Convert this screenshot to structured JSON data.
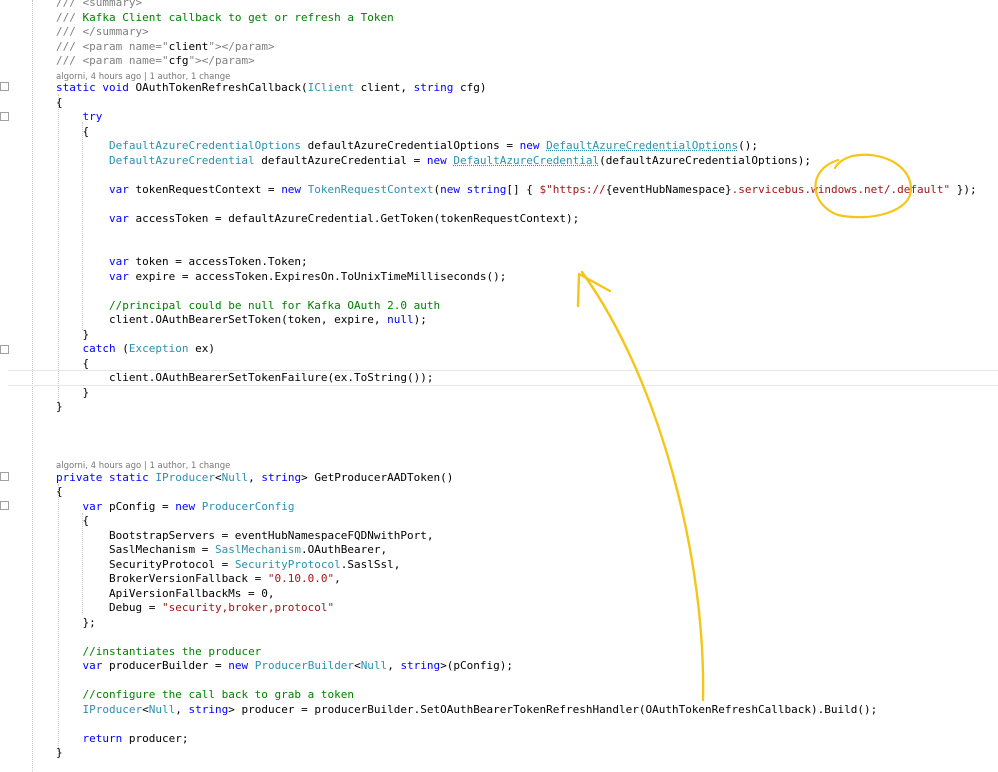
{
  "code": [
    {
      "kind": "code",
      "tokens": [
        {
          "t": "/// ",
          "c": "doc"
        },
        {
          "t": "<summary>",
          "c": "doc"
        }
      ]
    },
    {
      "kind": "code",
      "tokens": [
        {
          "t": "/// ",
          "c": "doc"
        },
        {
          "t": "Kafka Client callback to get or refresh a Token",
          "c": "cm"
        }
      ]
    },
    {
      "kind": "code",
      "tokens": [
        {
          "t": "/// ",
          "c": "doc"
        },
        {
          "t": "</summary>",
          "c": "doc"
        }
      ]
    },
    {
      "kind": "code",
      "tokens": [
        {
          "t": "/// ",
          "c": "doc"
        },
        {
          "t": "<param name=\"",
          "c": "doc"
        },
        {
          "t": "client",
          "c": "n"
        },
        {
          "t": "\"></param>",
          "c": "doc"
        }
      ]
    },
    {
      "kind": "code",
      "tokens": [
        {
          "t": "/// ",
          "c": "doc"
        },
        {
          "t": "<param name=\"",
          "c": "doc"
        },
        {
          "t": "cfg",
          "c": "n"
        },
        {
          "t": "\"></param>",
          "c": "doc"
        }
      ]
    },
    {
      "kind": "lens",
      "text": "algorni, 4 hours ago | 1 author, 1 change"
    },
    {
      "kind": "code",
      "tokens": [
        {
          "t": "static ",
          "c": "kw"
        },
        {
          "t": "void ",
          "c": "kw"
        },
        {
          "t": "OAuthTokenRefreshCallback(",
          "c": "n"
        },
        {
          "t": "IClient",
          "c": "ty"
        },
        {
          "t": " client, ",
          "c": "n"
        },
        {
          "t": "string",
          "c": "kw"
        },
        {
          "t": " cfg)",
          "c": "n"
        }
      ]
    },
    {
      "kind": "code",
      "tokens": [
        {
          "t": "{",
          "c": "n"
        }
      ]
    },
    {
      "kind": "code",
      "tokens": [
        {
          "t": "    try",
          "c": "kw"
        }
      ]
    },
    {
      "kind": "code",
      "tokens": [
        {
          "t": "    {",
          "c": "n"
        }
      ]
    },
    {
      "kind": "code",
      "tokens": [
        {
          "t": "        ",
          "c": "n"
        },
        {
          "t": "DefaultAzureCredentialOptions",
          "c": "ty"
        },
        {
          "t": " defaultAzureCredentialOptions = ",
          "c": "n"
        },
        {
          "t": "new ",
          "c": "kw"
        },
        {
          "t": "DefaultAzureCredentialOptions",
          "c": "ty sq"
        },
        {
          "t": "();",
          "c": "n"
        }
      ]
    },
    {
      "kind": "code",
      "tokens": [
        {
          "t": "        ",
          "c": "n"
        },
        {
          "t": "DefaultAzureCredential",
          "c": "ty"
        },
        {
          "t": " defaultAzureCredential = ",
          "c": "n"
        },
        {
          "t": "new ",
          "c": "kw"
        },
        {
          "t": "DefaultAzureCredential",
          "c": "ty sq"
        },
        {
          "t": "(defaultAzureCredentialOptions);",
          "c": "n"
        }
      ]
    },
    {
      "kind": "blank"
    },
    {
      "kind": "code",
      "tokens": [
        {
          "t": "        ",
          "c": "n"
        },
        {
          "t": "var ",
          "c": "kw"
        },
        {
          "t": "tokenRequestContext = ",
          "c": "n"
        },
        {
          "t": "new ",
          "c": "kw"
        },
        {
          "t": "TokenRequestContext",
          "c": "ty"
        },
        {
          "t": "(",
          "c": "n"
        },
        {
          "t": "new ",
          "c": "kw"
        },
        {
          "t": "string",
          "c": "kw"
        },
        {
          "t": "[] { ",
          "c": "n"
        },
        {
          "t": "$\"https://",
          "c": "st"
        },
        {
          "t": "{eventHubNamespace}",
          "c": "n"
        },
        {
          "t": ".servicebus.windows.net/.default\"",
          "c": "st"
        },
        {
          "t": " });",
          "c": "n"
        }
      ]
    },
    {
      "kind": "blank"
    },
    {
      "kind": "code",
      "tokens": [
        {
          "t": "        ",
          "c": "n"
        },
        {
          "t": "var ",
          "c": "kw"
        },
        {
          "t": "accessToken = defaultAzureCredential.GetToken(tokenRequestContext);",
          "c": "n"
        }
      ]
    },
    {
      "kind": "blank"
    },
    {
      "kind": "blank"
    },
    {
      "kind": "code",
      "tokens": [
        {
          "t": "        ",
          "c": "n"
        },
        {
          "t": "var ",
          "c": "kw"
        },
        {
          "t": "token = accessToken.Token;",
          "c": "n"
        }
      ]
    },
    {
      "kind": "code",
      "tokens": [
        {
          "t": "        ",
          "c": "n"
        },
        {
          "t": "var ",
          "c": "kw"
        },
        {
          "t": "expire = accessToken.ExpiresOn.ToUnixTimeMilliseconds();",
          "c": "n"
        }
      ]
    },
    {
      "kind": "blank"
    },
    {
      "kind": "code",
      "tokens": [
        {
          "t": "        ",
          "c": "n"
        },
        {
          "t": "//principal could be null for Kafka OAuth 2.0 auth",
          "c": "cm"
        }
      ]
    },
    {
      "kind": "code",
      "tokens": [
        {
          "t": "        client.OAuthBearerSetToken(token, expire, ",
          "c": "n"
        },
        {
          "t": "null",
          "c": "kw"
        },
        {
          "t": ");",
          "c": "n"
        }
      ]
    },
    {
      "kind": "code",
      "tokens": [
        {
          "t": "    }",
          "c": "n"
        }
      ]
    },
    {
      "kind": "code",
      "tokens": [
        {
          "t": "    catch ",
          "c": "kw"
        },
        {
          "t": "(",
          "c": "n"
        },
        {
          "t": "Exception",
          "c": "ty"
        },
        {
          "t": " ex)",
          "c": "n"
        }
      ]
    },
    {
      "kind": "code",
      "tokens": [
        {
          "t": "    {",
          "c": "n"
        }
      ]
    },
    {
      "kind": "code",
      "tokens": [
        {
          "t": "        client.OAuthBearerSetTokenFailure(ex.ToString());",
          "c": "n"
        }
      ]
    },
    {
      "kind": "code",
      "tokens": [
        {
          "t": "    }",
          "c": "n"
        }
      ]
    },
    {
      "kind": "code",
      "tokens": [
        {
          "t": "}",
          "c": "n"
        }
      ]
    },
    {
      "kind": "blank"
    },
    {
      "kind": "blank"
    },
    {
      "kind": "blank"
    },
    {
      "kind": "lens",
      "text": "algorni, 4 hours ago | 1 author, 1 change"
    },
    {
      "kind": "code",
      "tokens": [
        {
          "t": "private ",
          "c": "kw"
        },
        {
          "t": "static ",
          "c": "kw"
        },
        {
          "t": "IProducer",
          "c": "ty"
        },
        {
          "t": "<",
          "c": "n"
        },
        {
          "t": "Null",
          "c": "ty"
        },
        {
          "t": ", ",
          "c": "n"
        },
        {
          "t": "string",
          "c": "kw"
        },
        {
          "t": "> GetProducerAADToken()",
          "c": "n"
        }
      ]
    },
    {
      "kind": "code",
      "tokens": [
        {
          "t": "{",
          "c": "n"
        }
      ]
    },
    {
      "kind": "code",
      "tokens": [
        {
          "t": "    ",
          "c": "n"
        },
        {
          "t": "var ",
          "c": "kw"
        },
        {
          "t": "pConfig = ",
          "c": "n"
        },
        {
          "t": "new ",
          "c": "kw"
        },
        {
          "t": "ProducerConfig",
          "c": "ty"
        }
      ]
    },
    {
      "kind": "code",
      "tokens": [
        {
          "t": "    {",
          "c": "n"
        }
      ]
    },
    {
      "kind": "code",
      "tokens": [
        {
          "t": "        BootstrapServers = eventHubNamespaceFQDNwithPort,",
          "c": "n"
        }
      ]
    },
    {
      "kind": "code",
      "tokens": [
        {
          "t": "        SaslMechanism = ",
          "c": "n"
        },
        {
          "t": "SaslMechanism",
          "c": "ty"
        },
        {
          "t": ".OAuthBearer,",
          "c": "n"
        }
      ]
    },
    {
      "kind": "code",
      "tokens": [
        {
          "t": "        SecurityProtocol = ",
          "c": "n"
        },
        {
          "t": "SecurityProtocol",
          "c": "ty"
        },
        {
          "t": ".SaslSsl,",
          "c": "n"
        }
      ]
    },
    {
      "kind": "code",
      "tokens": [
        {
          "t": "        BrokerVersionFallback = ",
          "c": "n"
        },
        {
          "t": "\"0.10.0.0\"",
          "c": "st"
        },
        {
          "t": ",",
          "c": "n"
        }
      ]
    },
    {
      "kind": "code",
      "tokens": [
        {
          "t": "        ApiVersionFallbackMs = 0,",
          "c": "n"
        }
      ]
    },
    {
      "kind": "code",
      "tokens": [
        {
          "t": "        Debug = ",
          "c": "n"
        },
        {
          "t": "\"security,broker,protocol\"",
          "c": "st"
        }
      ]
    },
    {
      "kind": "code",
      "tokens": [
        {
          "t": "    };",
          "c": "n"
        }
      ]
    },
    {
      "kind": "blank"
    },
    {
      "kind": "code",
      "tokens": [
        {
          "t": "    ",
          "c": "n"
        },
        {
          "t": "//instantiates the producer",
          "c": "cm"
        }
      ]
    },
    {
      "kind": "code",
      "tokens": [
        {
          "t": "    ",
          "c": "n"
        },
        {
          "t": "var ",
          "c": "kw"
        },
        {
          "t": "producerBuilder = ",
          "c": "n"
        },
        {
          "t": "new ",
          "c": "kw"
        },
        {
          "t": "ProducerBuilder",
          "c": "ty"
        },
        {
          "t": "<",
          "c": "n"
        },
        {
          "t": "Null",
          "c": "ty"
        },
        {
          "t": ", ",
          "c": "n"
        },
        {
          "t": "string",
          "c": "kw"
        },
        {
          "t": ">(pConfig);",
          "c": "n"
        }
      ]
    },
    {
      "kind": "blank"
    },
    {
      "kind": "code",
      "tokens": [
        {
          "t": "    ",
          "c": "n"
        },
        {
          "t": "//configure the call back to grab a token",
          "c": "cm"
        }
      ]
    },
    {
      "kind": "code",
      "tokens": [
        {
          "t": "    ",
          "c": "n"
        },
        {
          "t": "IProducer",
          "c": "ty"
        },
        {
          "t": "<",
          "c": "n"
        },
        {
          "t": "Null",
          "c": "ty"
        },
        {
          "t": ", ",
          "c": "n"
        },
        {
          "t": "string",
          "c": "kw"
        },
        {
          "t": "> producer = producerBuilder.SetOAuthBearerTokenRefreshHandler(OAuthTokenRefreshCallback).Build();",
          "c": "n"
        }
      ]
    },
    {
      "kind": "blank"
    },
    {
      "kind": "code",
      "tokens": [
        {
          "t": "    ",
          "c": "n"
        },
        {
          "t": "return ",
          "c": "kw"
        },
        {
          "t": "producer;",
          "c": "n"
        }
      ]
    },
    {
      "kind": "code",
      "tokens": [
        {
          "t": "}",
          "c": "n"
        }
      ]
    }
  ],
  "annotation": {
    "color": "#f5c518"
  }
}
